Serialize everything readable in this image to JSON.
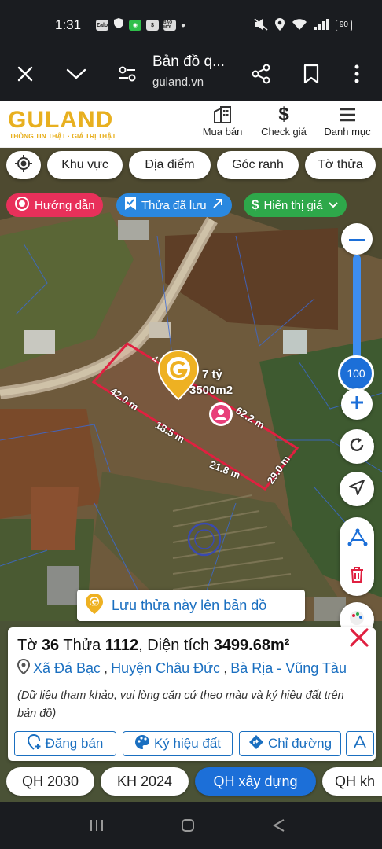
{
  "status_bar": {
    "time": "1:31",
    "app_icons": [
      "Zalo",
      "shield",
      "WeChat",
      "store",
      "BÁO MỚI"
    ],
    "battery": "90"
  },
  "browser": {
    "title": "Bản đồ q...",
    "url": "guland.vn"
  },
  "site": {
    "logo": "GULAND",
    "tagline": "THÔNG TIN THẬT · GIÁ TRỊ THẬT",
    "nav": [
      {
        "label": "Mua bán",
        "icon": "building-icon"
      },
      {
        "label": "Check giá",
        "icon": "dollar-icon"
      },
      {
        "label": "Danh mục",
        "icon": "menu-icon"
      }
    ]
  },
  "filters": {
    "area": "Khu vực",
    "place": "Địa điểm",
    "corner": "Góc ranh",
    "sheet": "Tờ thửa"
  },
  "pills": {
    "guide": "Hướng dẫn",
    "saved": "Thửa đã lưu",
    "price": "Hiển thị giá"
  },
  "plot": {
    "dim_top": "4",
    "dim_left": "42.0 m",
    "dim_bottom1": "18.5 m",
    "dim_bottom2": "21.8 m",
    "dim_right": "62.2 m",
    "dim_end": "29.0 m",
    "price": "7 tỷ",
    "area": "3500m2"
  },
  "zoom": {
    "level": "100"
  },
  "save_banner": "Lưu thửa này lên bản đồ",
  "info": {
    "sheet_label": "Tờ",
    "sheet": "36",
    "parcel_label": "Thửa",
    "parcel": "1112",
    "area_label": ", Diện tích",
    "area": "3499.68m²",
    "commune": "Xã Đá Bạc",
    "district": "Huyện Châu Đức",
    "province": "Bà Rịa - Vũng Tàu",
    "note": "(Dữ liệu tham khảo, vui lòng căn cứ theo màu và ký hiệu đất trên bản đồ)",
    "actions": [
      "Đăng bán",
      "Ký hiệu đất",
      "Chỉ đường"
    ]
  },
  "plan_tabs": [
    "QH 2030",
    "KH 2024",
    "QH xây dựng",
    "QH kh"
  ],
  "colors": {
    "accent": "#1c6fd8",
    "brand": "#e8b020",
    "plot_border": "#e02040",
    "guide": "#e8305a",
    "saved": "#2a88e0",
    "price": "#2ea84a"
  }
}
